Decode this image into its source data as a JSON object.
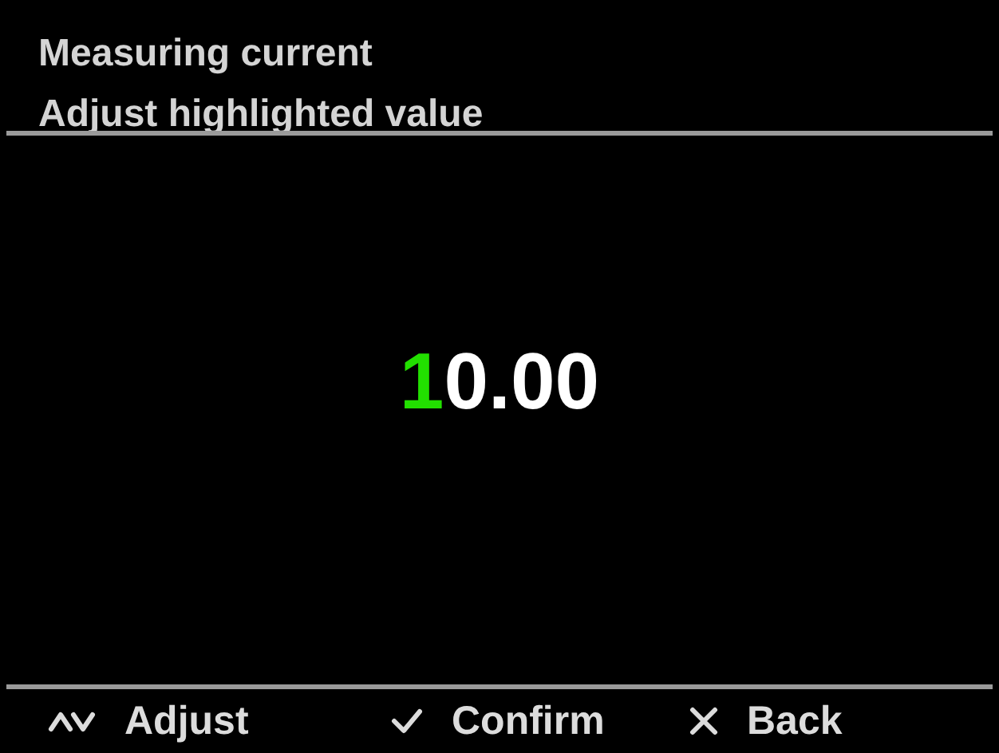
{
  "header": {
    "lines": [
      "Measuring current",
      "Adjust highlighted value"
    ]
  },
  "value": {
    "digits": [
      {
        "text": "1",
        "selected": true
      },
      {
        "text": "0",
        "selected": false
      },
      {
        "text": ".",
        "selected": false
      },
      {
        "text": "0",
        "selected": false
      },
      {
        "text": "0",
        "selected": false
      }
    ]
  },
  "softkeys": [
    {
      "kind": "updown",
      "label": "Adjust"
    },
    {
      "kind": "check",
      "label": "Confirm"
    },
    {
      "kind": "cross",
      "label": "Back"
    }
  ]
}
